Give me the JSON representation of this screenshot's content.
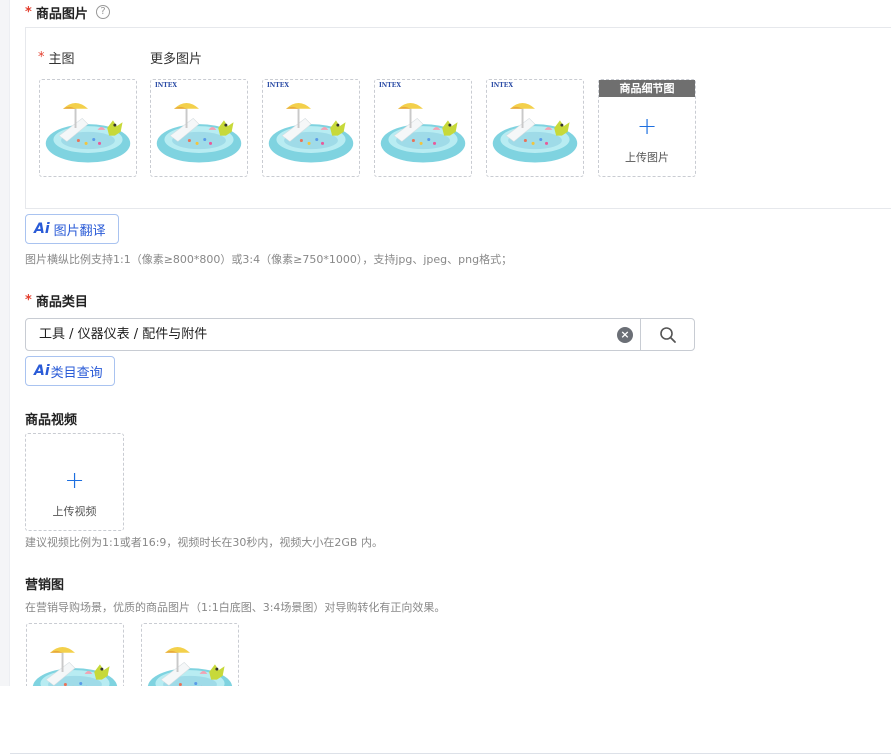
{
  "product_images": {
    "label": "商品图片",
    "required_mark": "*",
    "help_icon": "question-circle-icon",
    "main_label": "主图",
    "more_label": "更多图片",
    "brand_text": "INTEX",
    "thumb_count": 5,
    "detail_upload": {
      "header": "商品细节图",
      "plus": "+",
      "text": "上传图片"
    },
    "ai_button": {
      "mark": "Ai",
      "label": "图片翻译"
    },
    "hint": "图片横纵比例支持1:1（像素≥800*800）或3:4（像素≥750*1000），支持jpg、jpeg、png格式；"
  },
  "category": {
    "label": "商品类目",
    "required_mark": "*",
    "value": "工具 / 仪器仪表 / 配件与附件",
    "clear_icon": "close-circle-icon",
    "search_icon": "search-icon",
    "ai_button": {
      "mark": "Ai",
      "label": "类目查询"
    }
  },
  "video": {
    "label": "商品视频",
    "upload": {
      "plus": "+",
      "text": "上传视频"
    },
    "hint": "建议视频比例为1:1或者16:9，视频时长在30秒内，视频大小在2GB 内。"
  },
  "marketing": {
    "label": "营销图",
    "hint": "在营销导购场景，优质的商品图片（1:1白底图、3:4场景图）对导购转化有正向效果。"
  },
  "colors": {
    "required": "#e33e2e",
    "accent": "#1d6fe0",
    "ai": "#2a5bd7"
  }
}
